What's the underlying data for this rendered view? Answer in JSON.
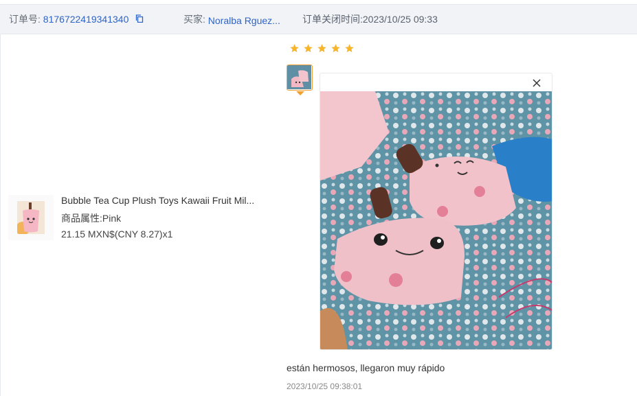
{
  "header": {
    "order_label": "订单号:",
    "order_number": "8176722419341340",
    "buyer_label": "买家:",
    "buyer_name": "Noralba Rguez...",
    "close_time": "订单关闭时间:2023/10/25 09:33"
  },
  "product": {
    "title": "Bubble Tea Cup Plush Toys Kawaii Fruit Mil...",
    "attr_label": "商品属性:",
    "attr_value": "Pink",
    "price": "21.15 MXN$(CNY  8.27)x1"
  },
  "review": {
    "rating": 5,
    "text": "están hermosos, llegaron muy rápido",
    "time": "2023/10/25 09:38:01"
  },
  "colors": {
    "link": "#2d63c8",
    "star": "#f7b52c",
    "thumb_border": "#f0a030",
    "header_bg": "#f1f3f6"
  },
  "icons": {
    "copy": "copy-icon",
    "star": "star-icon",
    "close": "close-icon"
  }
}
